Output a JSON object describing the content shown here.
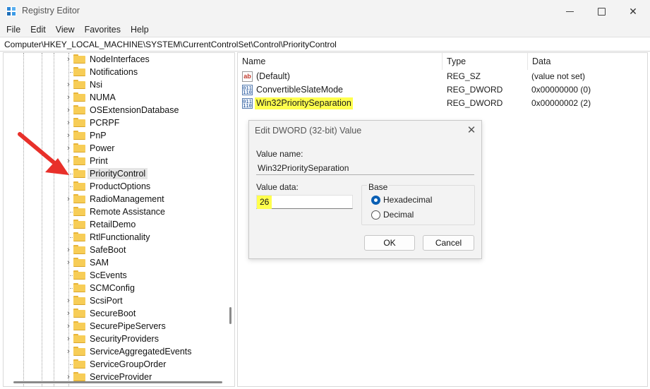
{
  "window": {
    "title": "Registry Editor",
    "icon": "regedit-icon",
    "controls": {
      "minimize": "minimize-icon",
      "maximize": "maximize-icon",
      "close": "✕"
    }
  },
  "menu": [
    "File",
    "Edit",
    "View",
    "Favorites",
    "Help"
  ],
  "address": "Computer\\HKEY_LOCAL_MACHINE\\SYSTEM\\CurrentControlSet\\Control\\PriorityControl",
  "tree": {
    "items": [
      {
        "label": "NodeInterfaces",
        "expandable": true
      },
      {
        "label": "Notifications",
        "expandable": false
      },
      {
        "label": "Nsi",
        "expandable": true
      },
      {
        "label": "NUMA",
        "expandable": true
      },
      {
        "label": "OSExtensionDatabase",
        "expandable": true
      },
      {
        "label": "PCRPF",
        "expandable": true
      },
      {
        "label": "PnP",
        "expandable": true
      },
      {
        "label": "Power",
        "expandable": true
      },
      {
        "label": "Print",
        "expandable": true
      },
      {
        "label": "PriorityControl",
        "expandable": false,
        "selected": true
      },
      {
        "label": "ProductOptions",
        "expandable": false
      },
      {
        "label": "RadioManagement",
        "expandable": true
      },
      {
        "label": "Remote Assistance",
        "expandable": false
      },
      {
        "label": "RetailDemo",
        "expandable": false
      },
      {
        "label": "RtlFunctionality",
        "expandable": false
      },
      {
        "label": "SafeBoot",
        "expandable": true
      },
      {
        "label": "SAM",
        "expandable": true
      },
      {
        "label": "ScEvents",
        "expandable": false
      },
      {
        "label": "SCMConfig",
        "expandable": false
      },
      {
        "label": "ScsiPort",
        "expandable": true
      },
      {
        "label": "SecureBoot",
        "expandable": true
      },
      {
        "label": "SecurePipeServers",
        "expandable": true
      },
      {
        "label": "SecurityProviders",
        "expandable": true
      },
      {
        "label": "ServiceAggregatedEvents",
        "expandable": true
      },
      {
        "label": "ServiceGroupOrder",
        "expandable": false
      },
      {
        "label": "ServiceProvider",
        "expandable": true
      }
    ]
  },
  "values": {
    "columns": {
      "name": "Name",
      "type": "Type",
      "data": "Data"
    },
    "rows": [
      {
        "name": "(Default)",
        "type": "REG_SZ",
        "data": "(value not set)",
        "icon": "string-value-icon",
        "highlighted": false
      },
      {
        "name": "ConvertibleSlateMode",
        "type": "REG_DWORD",
        "data": "0x00000000 (0)",
        "icon": "dword-value-icon",
        "highlighted": false
      },
      {
        "name": "Win32PrioritySeparation",
        "type": "REG_DWORD",
        "data": "0x00000002 (2)",
        "icon": "dword-value-icon",
        "highlighted": true
      }
    ]
  },
  "dialog": {
    "title": "Edit DWORD (32-bit) Value",
    "value_name_label": "Value name:",
    "value_name": "Win32PrioritySeparation",
    "value_data_label": "Value data:",
    "value_data": "26",
    "base_label": "Base",
    "base_options": [
      {
        "label": "Hexadecimal",
        "selected": true
      },
      {
        "label": "Decimal",
        "selected": false
      }
    ],
    "ok_label": "OK",
    "cancel_label": "Cancel",
    "close_glyph": "✕"
  },
  "colors": {
    "highlight": "#ffff4d",
    "arrow": "#e8302a",
    "folder": "#f7cd57",
    "radio_selected": "#0a5fb4"
  }
}
